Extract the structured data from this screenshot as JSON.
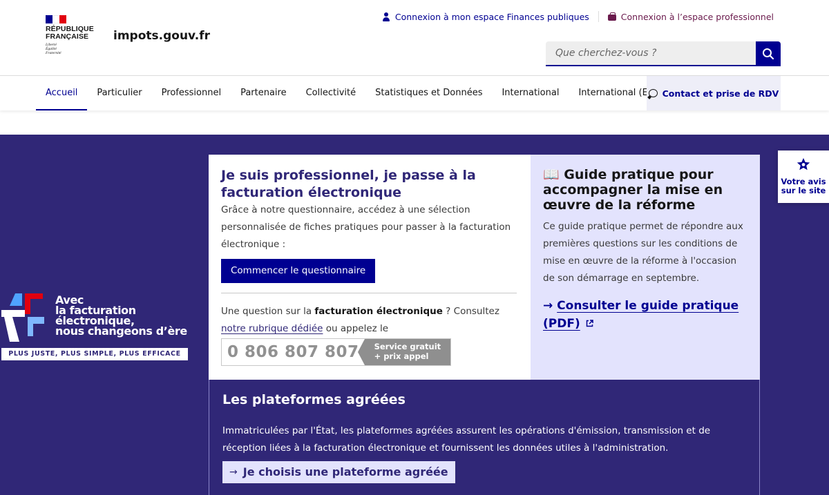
{
  "header": {
    "republic_lines": [
      "RÉPUBLIQUE",
      "FRANÇAISE"
    ],
    "motto_lines": [
      "Liberté",
      "Égalité",
      "Fraternité"
    ],
    "site_name": "impots.gouv.fr",
    "link_personal": "Connexion à mon espace Finances publiques",
    "link_pro": "Connexion à l’espace professionnel",
    "search_placeholder": "Que cherchez-vous ?"
  },
  "nav": {
    "items": [
      "Accueil",
      "Particulier",
      "Professionnel",
      "Partenaire",
      "Collectivité",
      "Statistiques et Données",
      "International",
      "International (EN)"
    ],
    "active": "Accueil",
    "contact": "Contact et prise de RDV"
  },
  "banner": {
    "lines": [
      "Avec",
      "la facturation",
      "électronique,",
      "nous changeons d’ère"
    ],
    "tagline": "PLUS JUSTE, PLUS SIMPLE, PLUS EFFICACE"
  },
  "card_pro": {
    "title": "Je suis professionnel, je passe à la facturation électronique",
    "text": "Grâce à notre questionnaire, accédez à une sélection personnalisée de fiches pratiques pour passer à la facturation électronique :",
    "button": "Commencer le questionnaire",
    "q_before": "Une question sur la ",
    "q_bold": "facturation électronique",
    "q_middle": " ? Consultez ",
    "q_link": "notre rubrique dédiée",
    "q_after": " ou appelez le",
    "phone": "0 806 807 807",
    "phone_tag_line1": "Service gratuit",
    "phone_tag_line2": "+ prix appel"
  },
  "card_guide": {
    "icon": "📖",
    "title": "Guide pratique pour accompagner la mise en œuvre de la réforme",
    "text": "Ce guide pratique permet de répondre aux premières questions sur les conditions de mise en œuvre de la réforme à l'occasion de son démarrage en septembre.",
    "link": "Consulter le guide pratique (PDF)"
  },
  "card_platforms": {
    "title": "Les plateformes agréées",
    "text": "Immatriculées par l'État, les plateformes agréées assurent les opérations d'émission, transmission et de réception liées à la facturation électronique et fournissent les données utiles à l'administration.",
    "button": "Je choisis une plateforme agréée"
  },
  "feedback": {
    "label_line1": "Votre avis",
    "label_line2": "sur le site"
  },
  "colors": {
    "primary": "#000091",
    "hero_bg": "#302777",
    "guide_bg": "#e3e3fd",
    "pro_link": "#6a1a4c"
  }
}
